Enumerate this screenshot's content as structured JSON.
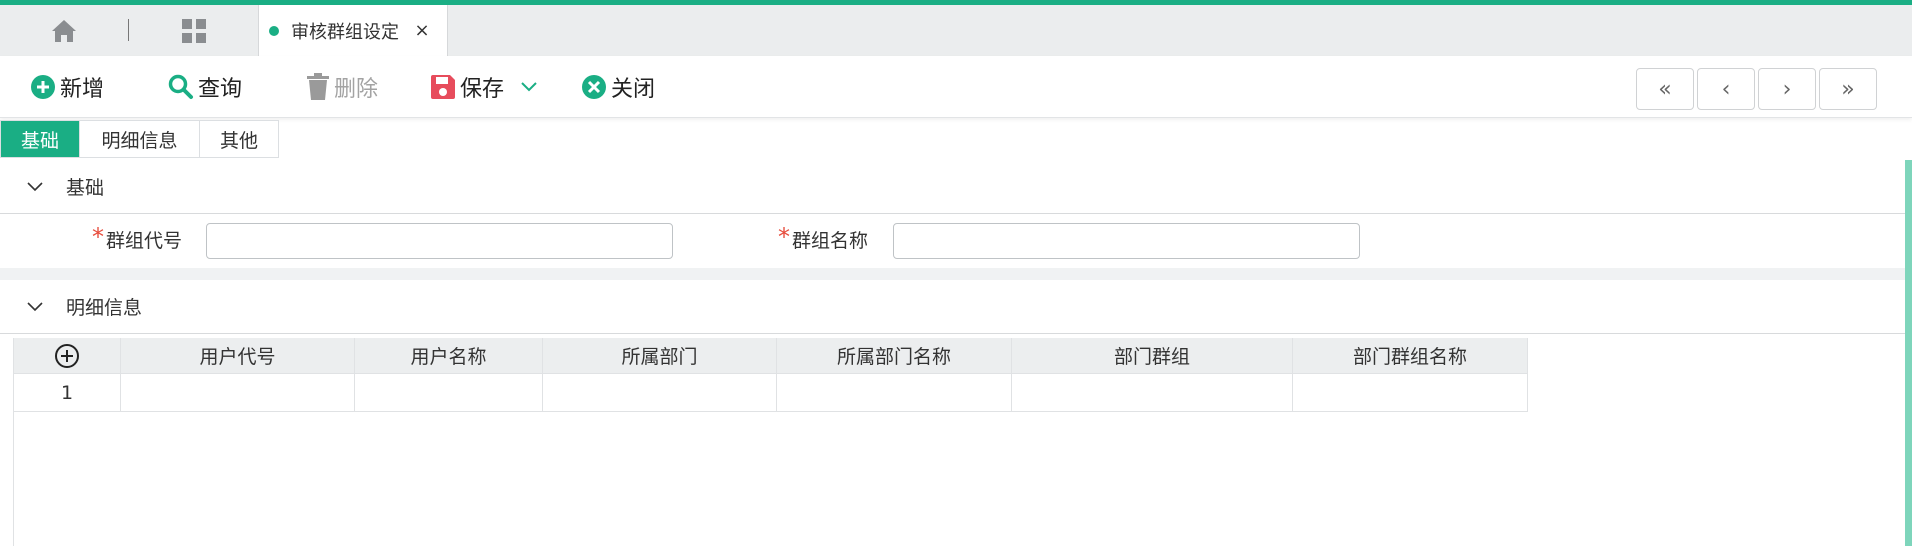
{
  "tabbar": {
    "home_icon": "home-icon",
    "grid_icon": "grid-icon",
    "active_tab": {
      "title": "审核群组设定",
      "close": "×"
    }
  },
  "toolbar": {
    "add_label": "新增",
    "query_label": "查询",
    "delete_label": "删除",
    "save_label": "保存",
    "close_label": "关闭",
    "nav": {
      "first": "«",
      "prev": "‹",
      "next": "›",
      "last": "»"
    }
  },
  "subtabs": [
    {
      "label": "基础",
      "active": true
    },
    {
      "label": "明细信息",
      "active": false
    },
    {
      "label": "其他",
      "active": false
    }
  ],
  "sections": {
    "basic": {
      "title": "基础",
      "fields": [
        {
          "label": "群组代号",
          "required": true,
          "value": ""
        },
        {
          "label": "群组名称",
          "required": true,
          "value": ""
        }
      ]
    },
    "detail": {
      "title": "明细信息",
      "table": {
        "columns": [
          "用户代号",
          "用户名称",
          "所属部门",
          "所属部门名称",
          "部门群组",
          "部门群组名称"
        ],
        "rows": [
          {
            "index": "1",
            "cells": [
              "",
              "",
              "",
              "",
              "",
              ""
            ]
          }
        ]
      }
    }
  },
  "colors": {
    "accent": "#1aae84",
    "save_icon": "#e74c5c",
    "required": "#e74c3c",
    "header_bg": "#eceeef"
  }
}
